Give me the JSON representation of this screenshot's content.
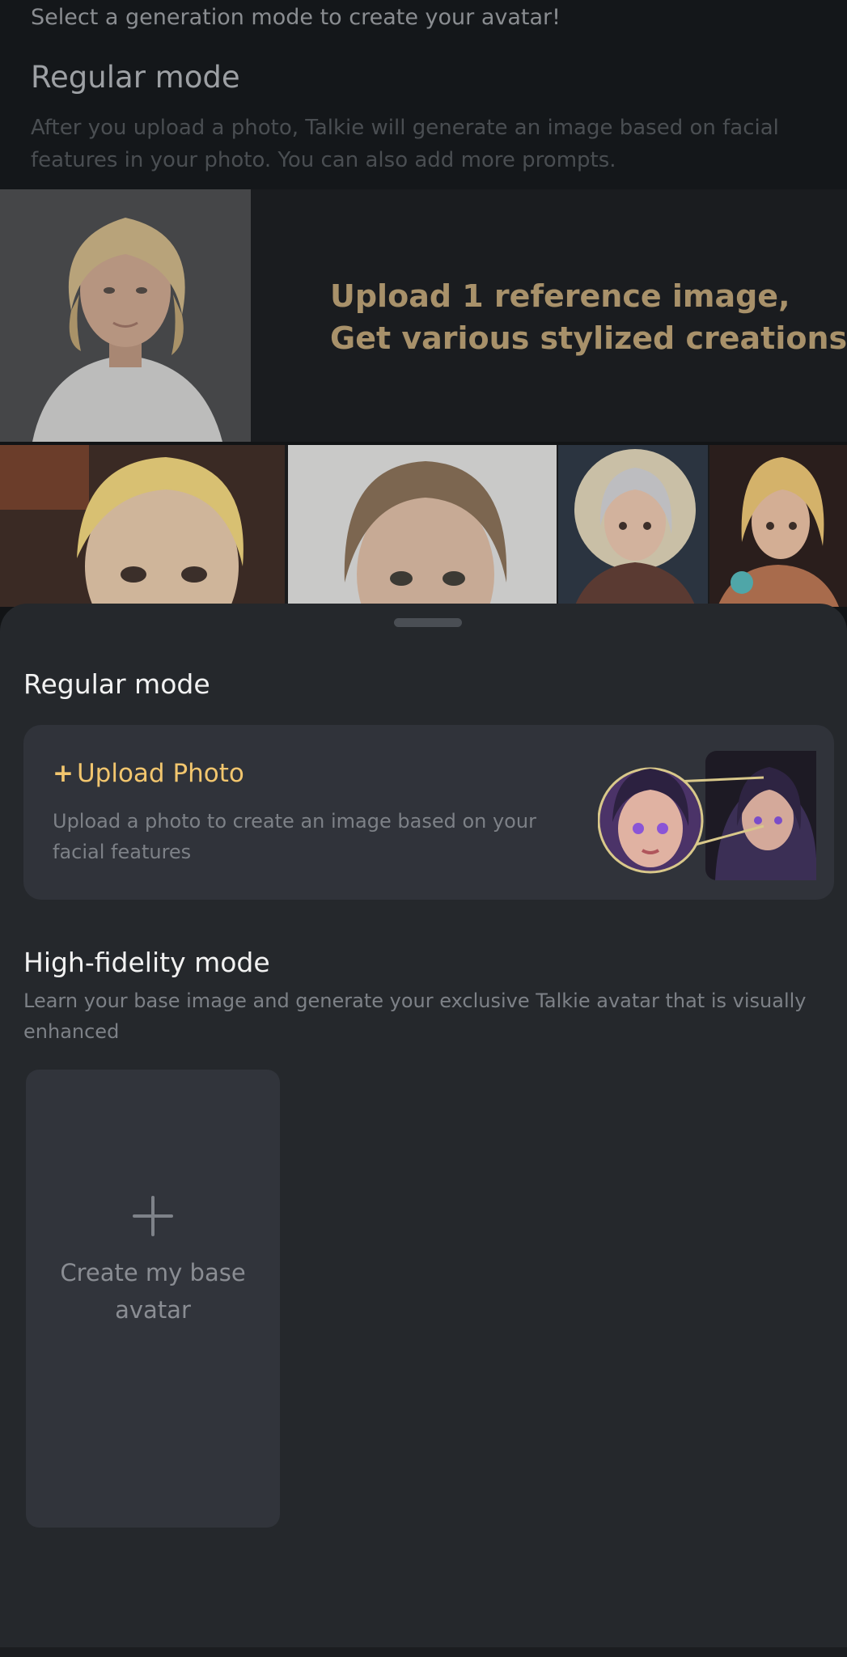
{
  "background": {
    "intro": "Select a generation mode to create your avatar!",
    "mode_title": "Regular mode",
    "mode_description": "After you upload a photo, Talkie will generate an image based on facial features in your photo. You can also add more prompts.",
    "banner_line1": "Upload 1 reference image,",
    "banner_line2": "Get various stylized creations!"
  },
  "sheet": {
    "regular_title": "Regular mode",
    "upload_label": "Upload Photo",
    "upload_plus": "+",
    "upload_description": "Upload a photo to create an image based on your facial features",
    "hf_title": "High-fidelity mode",
    "hf_description": "Learn your base image and generate your exclusive Talkie avatar that is visually enhanced",
    "base_label": "Create my base avatar"
  },
  "colors": {
    "accent": "#f2c66e",
    "sheet_bg": "#25282c",
    "card_bg": "#30333a"
  },
  "icons": {
    "upload": "plus-icon",
    "base": "plus-icon"
  }
}
